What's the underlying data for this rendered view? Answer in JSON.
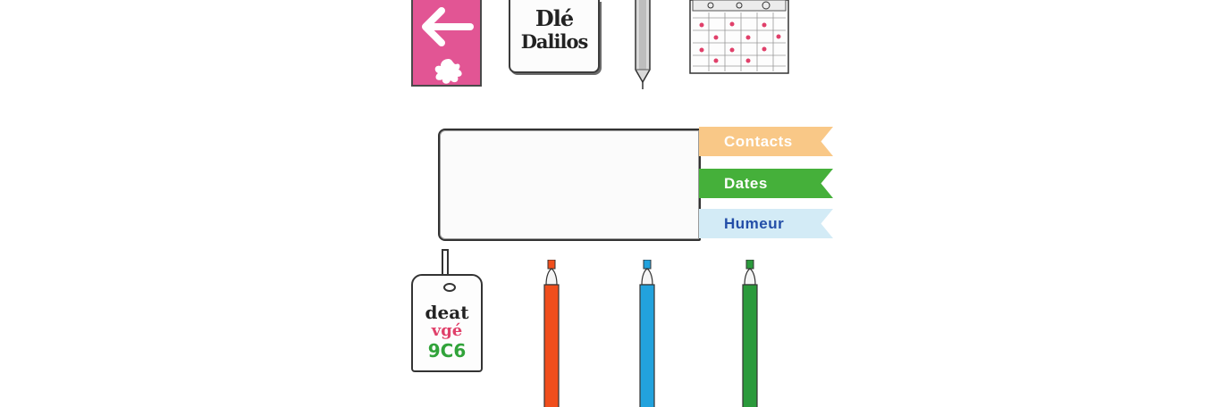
{
  "top_row": {
    "notebook": {
      "line1": "Dlé",
      "line2": "Dalilos"
    }
  },
  "tabs": [
    {
      "label": "Contacts"
    },
    {
      "label": "Dates"
    },
    {
      "label": "Humeur"
    }
  ],
  "tag": {
    "line1": "deat",
    "line2": "vgé",
    "line3": "9C6"
  },
  "colors": {
    "back_book": "#e25594",
    "tab_contacts": "#f9c887",
    "tab_dates": "#45b03a",
    "tab_humeur": "#d3ebf6",
    "tab_humeur_text": "#234ea8",
    "marker_red": "#f04e1c",
    "marker_blue": "#22a2dd",
    "marker_green": "#2b9a3c"
  },
  "icons": {
    "back": "arrow-left-icon",
    "pen": "pen-icon",
    "calendar": "calendar-icon",
    "tag": "tag-icon",
    "markers": [
      "red-marker-icon",
      "blue-marker-icon",
      "green-marker-icon"
    ]
  }
}
